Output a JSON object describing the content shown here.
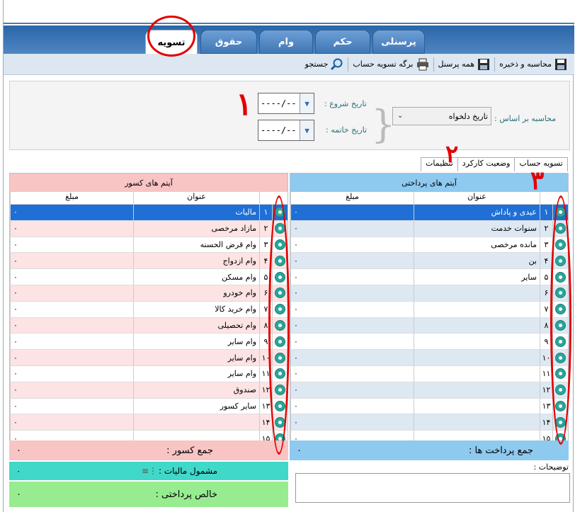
{
  "tabs": [
    {
      "label": "تسویه",
      "active": true
    },
    {
      "label": "حقوق",
      "active": false
    },
    {
      "label": "وام",
      "active": false
    },
    {
      "label": "حکم",
      "active": false
    },
    {
      "label": "پرسنلی",
      "active": false
    }
  ],
  "toolbar": {
    "calc_save": "محاسبه و ذخیره",
    "all_personnel": "همه پرسنل",
    "settlement_sheet": "برگه تسویه حساب",
    "search": "جستجو"
  },
  "filter": {
    "calc_basis_label": "محاسبه بر اساس :",
    "calc_basis_value": "تاریخ دلخواه",
    "start_date_label": "تاریخ شروع :",
    "end_date_label": "تاریخ خاتمه :",
    "start_date_value": "----/--",
    "end_date_value": "----/--"
  },
  "subtabs": [
    {
      "label": "تسویه حساب",
      "active": true
    },
    {
      "label": "وضعیت کارکرد",
      "active": false
    },
    {
      "label": "تنظیمات",
      "active": false
    }
  ],
  "payments": {
    "title": "آیتم های پرداختی",
    "col_title": "عنوان",
    "col_amount": "مبلغ",
    "rows": [
      {
        "n": "۱",
        "title": "عیدی و پاداش",
        "amount": "۰"
      },
      {
        "n": "۲",
        "title": "سنوات خدمت",
        "amount": "۰"
      },
      {
        "n": "۳",
        "title": "مانده مرخصی",
        "amount": "۰"
      },
      {
        "n": "۴",
        "title": "بن",
        "amount": "۰"
      },
      {
        "n": "۵",
        "title": "سایر",
        "amount": "۰"
      },
      {
        "n": "۶",
        "title": "",
        "amount": "۰"
      },
      {
        "n": "۷",
        "title": "",
        "amount": "۰"
      },
      {
        "n": "۸",
        "title": "",
        "amount": "۰"
      },
      {
        "n": "۹",
        "title": "",
        "amount": "۰"
      },
      {
        "n": "۱۰",
        "title": "",
        "amount": "۰"
      },
      {
        "n": "۱۱",
        "title": "",
        "amount": "۰"
      },
      {
        "n": "۱۲",
        "title": "",
        "amount": "۰"
      },
      {
        "n": "۱۳",
        "title": "",
        "amount": "۰"
      },
      {
        "n": "۱۴",
        "title": "",
        "amount": "۰"
      },
      {
        "n": "۱۵",
        "title": "",
        "amount": "۰"
      }
    ],
    "sum_label": "جمع پرداخت ها :",
    "sum_value": "۰"
  },
  "deductions": {
    "title": "آیتم های کسور",
    "col_title": "عنوان",
    "col_amount": "مبلغ",
    "rows": [
      {
        "n": "۱",
        "title": "مالیات",
        "amount": "۰"
      },
      {
        "n": "۲",
        "title": "مازاد مرخصی",
        "amount": "۰"
      },
      {
        "n": "۳",
        "title": "وام قرض الحسنه",
        "amount": "۰"
      },
      {
        "n": "۴",
        "title": "وام ازدواج",
        "amount": "۰"
      },
      {
        "n": "۵",
        "title": "وام مسکن",
        "amount": "۰"
      },
      {
        "n": "۶",
        "title": "وام خودرو",
        "amount": "۰"
      },
      {
        "n": "۷",
        "title": "وام خرید کالا",
        "amount": "۰"
      },
      {
        "n": "۸",
        "title": "وام تحصیلی",
        "amount": "۰"
      },
      {
        "n": "۹",
        "title": "وام سایر",
        "amount": "۰"
      },
      {
        "n": "۱۰",
        "title": "وام سایر",
        "amount": "۰"
      },
      {
        "n": "۱۱",
        "title": "وام سایر",
        "amount": "۰"
      },
      {
        "n": "۱۲",
        "title": "صندوق",
        "amount": "۰"
      },
      {
        "n": "۱۳",
        "title": "سایر کسور",
        "amount": "۰"
      },
      {
        "n": "۱۴",
        "title": "",
        "amount": "۰"
      },
      {
        "n": "۱۵",
        "title": "",
        "amount": "۰"
      }
    ],
    "sum_label": "جمع کسور :",
    "sum_value": "۰"
  },
  "taxable": {
    "label": "مشمول مالیات :",
    "value": "۰"
  },
  "net": {
    "label": "خالص پرداختی :",
    "value": "۰"
  },
  "notes": {
    "label": "توضیحات :"
  },
  "annotations": {
    "one": "۱",
    "two": "۲",
    "three": "۳"
  },
  "colors": {
    "tab_blue": "#3f76b6",
    "payments_header": "#8ec9f0",
    "deductions_header": "#f8c4c4",
    "row_blue_alt": "#dde8f2",
    "row_pink_alt": "#fde3e3",
    "selected": "#1f6fd6",
    "taxable": "#40d8c8",
    "net": "#98ec90",
    "annotation_red": "#e10000"
  }
}
